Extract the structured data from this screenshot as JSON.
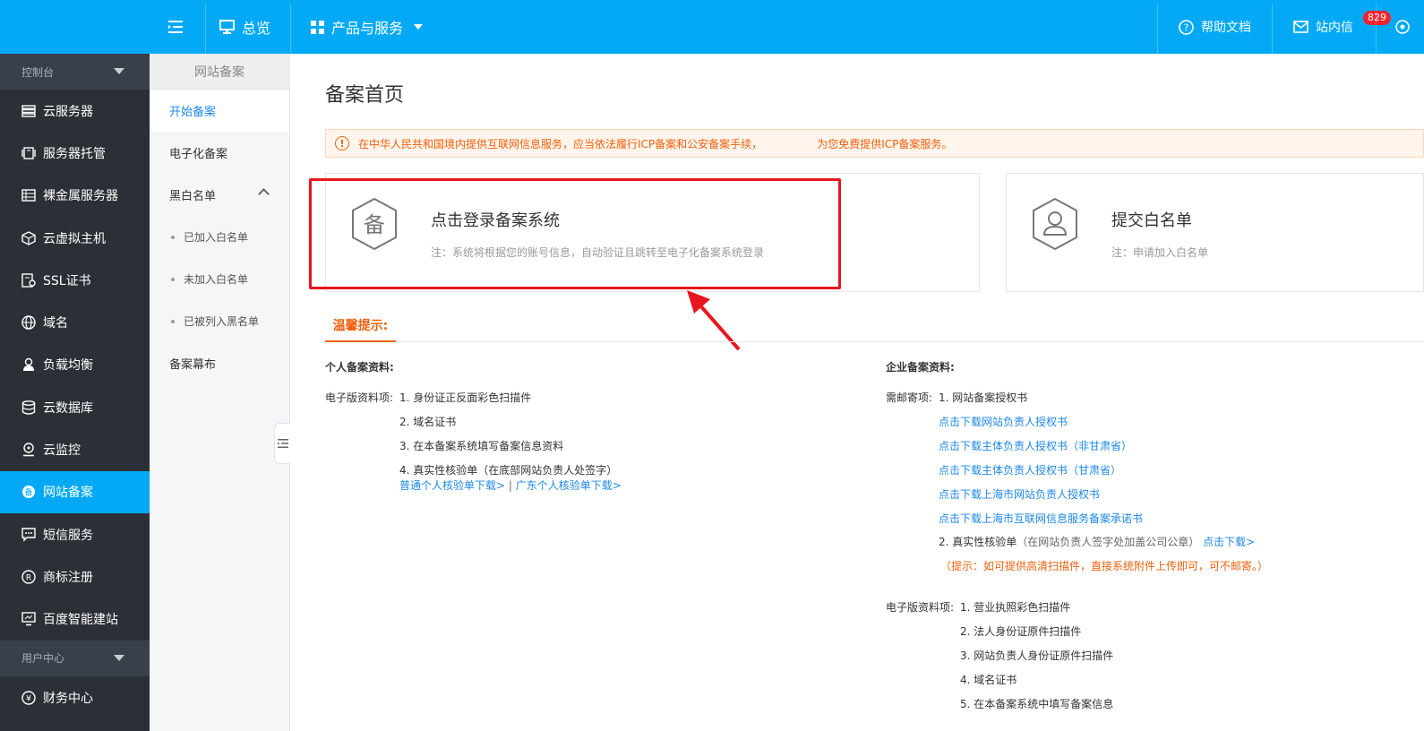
{
  "topbar": {
    "overview": "总览",
    "products": "产品与服务",
    "help": "帮助文档",
    "messages": "站内信",
    "badge": "829"
  },
  "sidebar": {
    "group1": "控制台",
    "items": [
      "云服务器",
      "服务器托管",
      "裸金属服务器",
      "云虚拟主机",
      "SSL证书",
      "域名",
      "负载均衡",
      "云数据库",
      "云监控",
      "网站备案",
      "短信服务",
      "商标注册",
      "百度智能建站"
    ],
    "group2": "用户中心",
    "items2": [
      "财务中心"
    ]
  },
  "submenu": {
    "title": "网站备案",
    "start": "开始备案",
    "electronic": "电子化备案",
    "bw": "黑白名单",
    "bw_items": [
      "已加入白名单",
      "未加入白名单",
      "已被列入黑名单"
    ],
    "curtain": "备案幕布"
  },
  "main": {
    "title": "备案首页",
    "notice": "在中华人民共和国境内提供互联网信息服务，应当依法履行ICP备案和公安备案手续，                为您免费提供ICP备案服务。",
    "card1": {
      "icon_char": "备",
      "title": "点击登录备案系统",
      "note": "注：系统将根据您的账号信息，自动验证且跳转至电子化备案系统登录"
    },
    "card2": {
      "title": "提交白名单",
      "note": "注：申请加入白名单"
    },
    "tab": "温馨提示:",
    "personal": {
      "title": "个人备案资料:",
      "label": "电子版资料项:",
      "items": [
        "1. 身份证正反面彩色扫描件",
        "2. 域名证书",
        "3. 在本备案系统填写备案信息资料",
        "4. 真实性核验单（在底部网站负责人处签字）"
      ],
      "link1": "普通个人核验单下载>",
      "divider": "|",
      "link2": "广东个人核验单下载>"
    },
    "enterprise": {
      "title": "企业备案资料:",
      "mail_label": "需邮寄项:",
      "mail_item1": "1. 网站备案授权书",
      "links": [
        "点击下载网站负责人授权书",
        "点击下载主体负责人授权书（非甘肃省）",
        "点击下载主体负责人授权书（甘肃省）",
        "点击下载上海市网站负责人授权书",
        "点击下载上海市互联网信息服务备案承诺书"
      ],
      "mail_item2": "2. 真实性核验单",
      "mail_item2_note": "（在网站负责人签字处加盖公司公章）",
      "mail_item2_link": "点击下载>",
      "tip": "（提示：如可提供高清扫描件，直接系统附件上传即可，可不邮寄。）",
      "elec_label": "电子版资料项:",
      "elec_items": [
        "1. 营业执照彩色扫描件",
        "2. 法人身份证原件扫描件",
        "3. 网站负责人身份证原件扫描件",
        "4. 域名证书",
        "5. 在本备案系统中填写备案信息"
      ]
    }
  },
  "colors": {
    "brand": "#03a9f4",
    "sidebar": "#2b3036",
    "warn": "#f0600d",
    "link": "#1e88e5",
    "highlight": "#e8161f"
  }
}
